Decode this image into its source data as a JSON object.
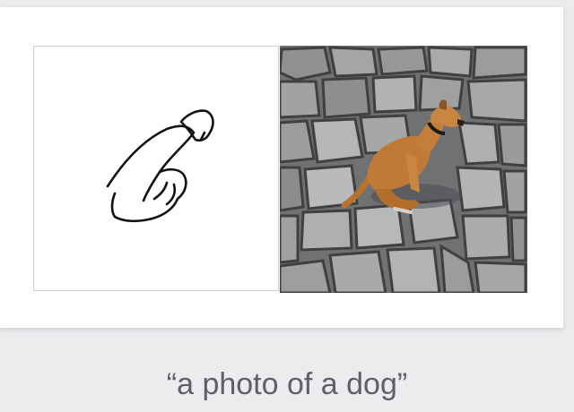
{
  "caption": {
    "text": "“a photo of a dog”"
  },
  "panels": {
    "sketch": {
      "content": "line-drawing-icon"
    },
    "photo": {
      "content": "dog-on-cobblestone-image"
    }
  },
  "colors": {
    "page_bg": "#ececef",
    "card_bg": "#ffffff",
    "caption_text": "#5f6166",
    "stone_light": "#a9abad",
    "stone_dark": "#55575a",
    "dog_fur": "#b8722f"
  }
}
